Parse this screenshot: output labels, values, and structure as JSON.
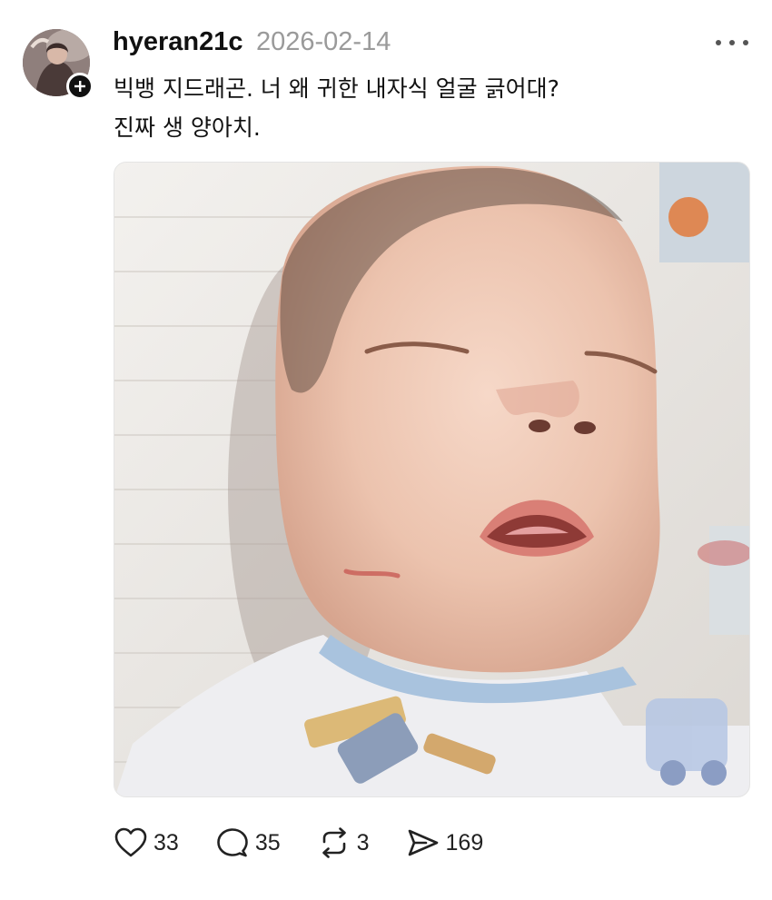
{
  "post": {
    "username": "hyeran21c",
    "timestamp": "2026-02-14",
    "text_lines": [
      "빅뱅 지드래곤. 너 왜 귀한 내자식 얼굴 긁어대?",
      "진짜 생 양아치."
    ],
    "photo": {
      "icon": "photo-of-sleeping-baby-with-scratch"
    }
  },
  "actions": {
    "like": {
      "icon": "heart-icon",
      "count": "33"
    },
    "reply": {
      "icon": "comment-icon",
      "count": "35"
    },
    "repost": {
      "icon": "repost-icon",
      "count": "3"
    },
    "share": {
      "icon": "send-icon",
      "count": "169"
    }
  },
  "menu": {
    "icon": "more-options-icon"
  },
  "colors": {
    "text": "#111111",
    "muted": "#9a9a9a",
    "icon": "#222222",
    "background": "#ffffff"
  }
}
